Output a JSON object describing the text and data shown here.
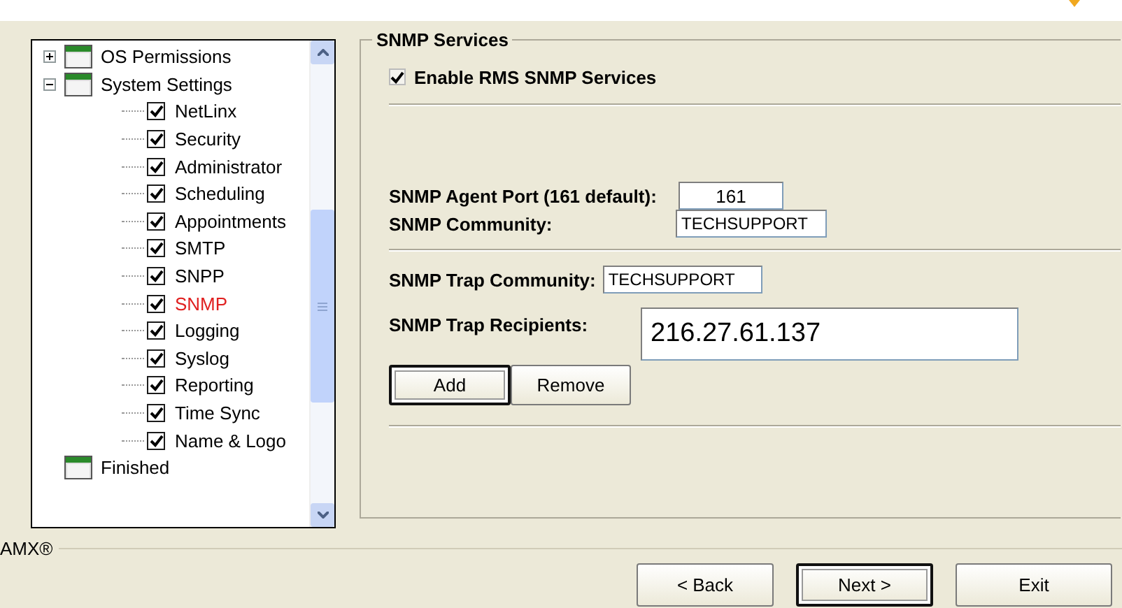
{
  "tree": [
    {
      "label": "OS Permissions",
      "kind": "folder",
      "expanded": false
    },
    {
      "label": "System Settings",
      "kind": "folder",
      "expanded": true,
      "children": [
        {
          "label": "NetLinx",
          "checked": true,
          "selected": false
        },
        {
          "label": "Security",
          "checked": true,
          "selected": false
        },
        {
          "label": "Administrator",
          "checked": true,
          "selected": false
        },
        {
          "label": "Scheduling",
          "checked": true,
          "selected": false
        },
        {
          "label": "Appointments",
          "checked": true,
          "selected": false
        },
        {
          "label": "SMTP",
          "checked": true,
          "selected": false
        },
        {
          "label": "SNPP",
          "checked": true,
          "selected": false
        },
        {
          "label": "SNMP",
          "checked": true,
          "selected": true
        },
        {
          "label": "Logging",
          "checked": true,
          "selected": false
        },
        {
          "label": "Syslog",
          "checked": true,
          "selected": false
        },
        {
          "label": "Reporting",
          "checked": true,
          "selected": false
        },
        {
          "label": "Time Sync",
          "checked": true,
          "selected": false
        },
        {
          "label": "Name & Logo",
          "checked": true,
          "selected": false
        }
      ]
    },
    {
      "label": "Finished",
      "kind": "page"
    }
  ],
  "brand": "AMX®",
  "group": {
    "title": "SNMP Services",
    "enable": {
      "label": "Enable RMS SNMP Services",
      "checked": true
    },
    "agent_port": {
      "label": "SNMP Agent Port (161 default):",
      "value": "161"
    },
    "community": {
      "label": "SNMP Community:",
      "value": "TECHSUPPORT"
    },
    "trap_community": {
      "label": "SNMP Trap Community:",
      "value": "TECHSUPPORT"
    },
    "trap_recipients": {
      "label": "SNMP Trap Recipients:",
      "value": "216.27.61.137"
    },
    "buttons": [
      {
        "label": "Add",
        "focused": true
      },
      {
        "label": "Remove",
        "focused": false
      }
    ]
  },
  "footer_buttons": [
    {
      "label": "< Back",
      "focused": false
    },
    {
      "label": "Next >",
      "focused": true
    },
    {
      "label": "Exit",
      "focused": false
    }
  ]
}
